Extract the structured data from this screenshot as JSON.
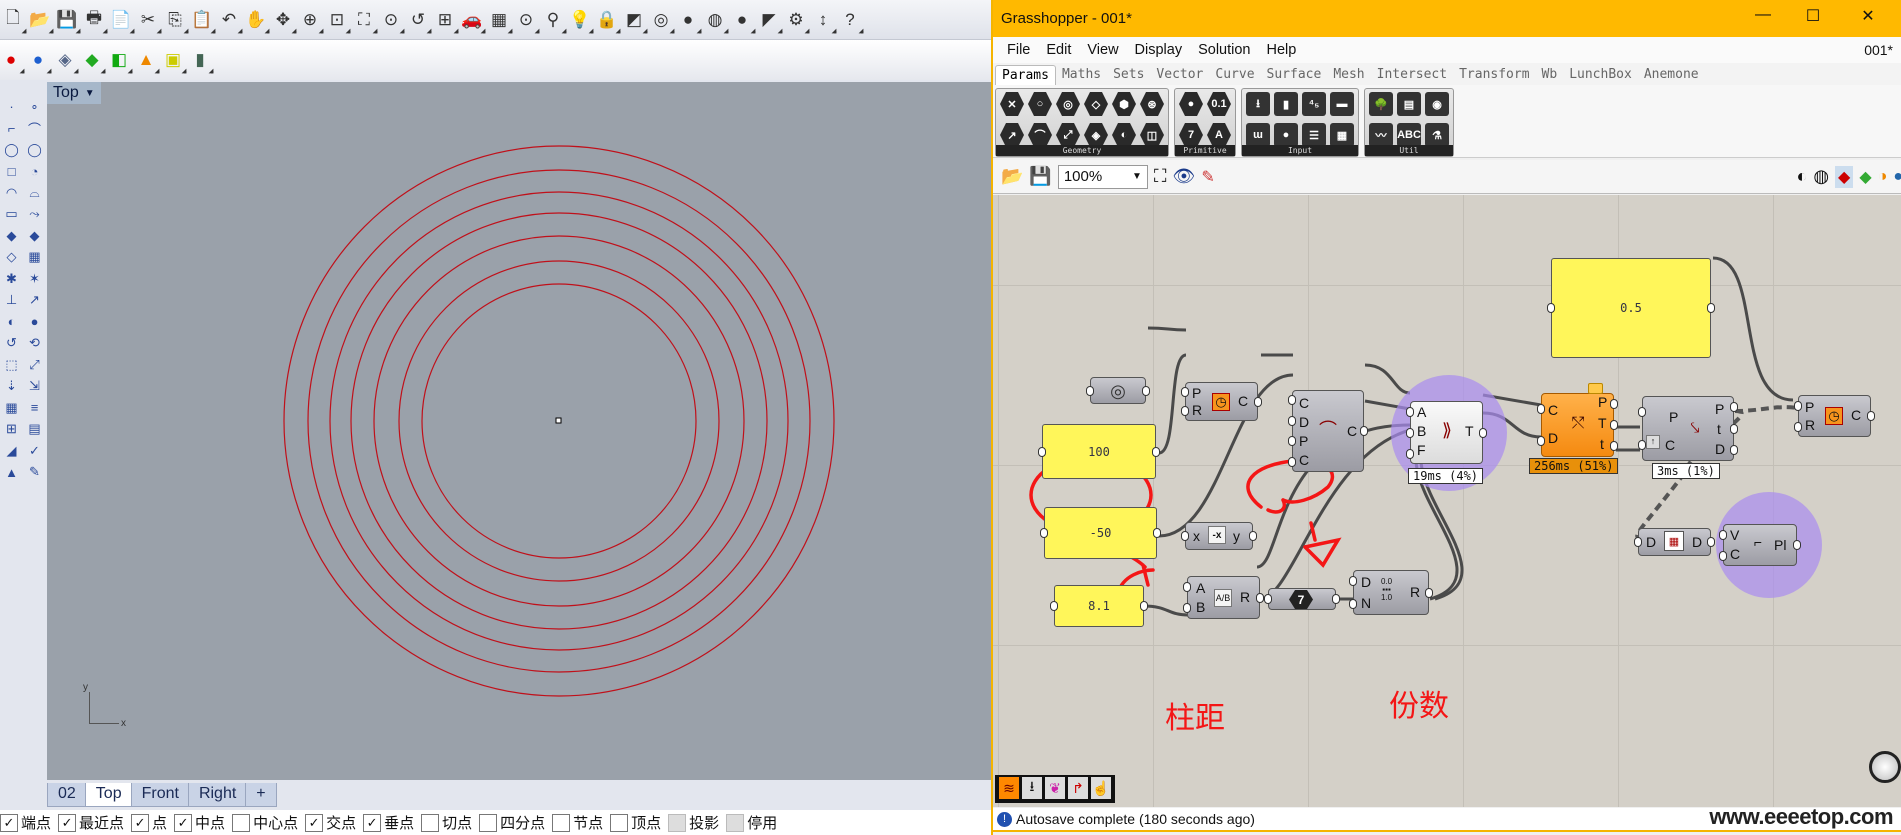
{
  "rhino": {
    "toolbar1_icons": [
      "new-icon",
      "open-icon",
      "save-icon",
      "print-icon",
      "import-icon",
      "cut-icon",
      "copy-icon",
      "paste-icon",
      "undo-icon",
      "pan-icon",
      "rotate-view-icon",
      "zoom-icon",
      "zoom-window-icon",
      "zoom-extents-icon",
      "zoom-selected-icon",
      "undo-view-icon",
      "four-viewports-icon",
      "car-icon",
      "grid-icon",
      "osnap-icon",
      "properties-icon",
      "light-icon",
      "lock-icon",
      "layer-icon",
      "color-wheel-icon",
      "shaded-sphere-icon",
      "rendered-sphere-icon",
      "blue-sphere-icon",
      "flag-icon",
      "settings-icon",
      "dimension-icon",
      "help-icon"
    ],
    "toolbar1_glyphs": [
      "🗋",
      "📂",
      "💾",
      "🖶",
      "📄",
      "✂",
      "⎘",
      "📋",
      "↶",
      "✋",
      "✥",
      "⊕",
      "⊡",
      "⛶",
      "⊙",
      "↺",
      "⊞",
      "🚗",
      "▦",
      "⊙",
      "⚲",
      "💡",
      "🔒",
      "◩",
      "◎",
      "●",
      "◍",
      "●",
      "◤",
      "⚙",
      "↕",
      "?"
    ],
    "toolbar2_icons": [
      "red-sphere-icon",
      "blue-sphere-icon",
      "gem-icon",
      "mesh-icon",
      "box-icon",
      "cone-icon",
      "cage-icon",
      "cylinder-icon"
    ],
    "toolbar2_glyphs": [
      "●",
      "●",
      "◈",
      "◆",
      "◧",
      "▲",
      "▣",
      "▮"
    ],
    "viewport_label": "Top",
    "axis_x": "x",
    "axis_y": "y",
    "circle_color": "#c0101a",
    "viewport_tabs": [
      "02",
      "Top",
      "Front",
      "Right",
      "+"
    ],
    "active_tab": "Top",
    "osnaps": [
      {
        "label": "端点",
        "checked": true
      },
      {
        "label": "最近点",
        "checked": true
      },
      {
        "label": "点",
        "checked": true
      },
      {
        "label": "中点",
        "checked": true
      },
      {
        "label": "中心点",
        "checked": false
      },
      {
        "label": "交点",
        "checked": true
      },
      {
        "label": "垂点",
        "checked": true
      },
      {
        "label": "切点",
        "checked": false
      },
      {
        "label": "四分点",
        "checked": false
      },
      {
        "label": "节点",
        "checked": false
      },
      {
        "label": "顶点",
        "checked": false
      },
      {
        "label": "投影",
        "checked": false,
        "disabled": true
      },
      {
        "label": "停用",
        "checked": false,
        "disabled": true
      }
    ]
  },
  "grasshopper": {
    "title": "Grasshopper - 001*",
    "doc_name": "001*",
    "window_controls": {
      "minimize": "—",
      "maximize": "☐",
      "close": "✕"
    },
    "menu": [
      "File",
      "Edit",
      "View",
      "Display",
      "Solution",
      "Help"
    ],
    "tabs": [
      "Params",
      "Maths",
      "Sets",
      "Vector",
      "Curve",
      "Surface",
      "Mesh",
      "Intersect",
      "Transform",
      "Wb",
      "LunchBox",
      "Anemone"
    ],
    "active_tab": "Params",
    "ribbon_groups": [
      {
        "label": "Geometry",
        "icons": [
          "✕",
          "↗",
          "○",
          "⌒",
          "◎",
          "⤢",
          "◇",
          "◈",
          "⬢",
          "◐",
          "⊛",
          "◫"
        ]
      },
      {
        "label": "Primitive",
        "icons": [
          "●",
          "7",
          "0.1",
          "A"
        ]
      },
      {
        "label": "Input",
        "icons": [
          "⭳",
          "ɯ",
          "▮",
          "●",
          "⁴₅",
          "☰",
          "▬",
          "▦"
        ]
      },
      {
        "label": "Util",
        "icons": [
          "🌳",
          "〰",
          "▤",
          "ABC",
          "◉",
          "⚗"
        ]
      }
    ],
    "zoom_level": "100%",
    "accent": "#ffb900",
    "canvas": {
      "panels": {
        "p05": "0.5",
        "p100": "100",
        "pm50": "-50",
        "p81": "8.1"
      },
      "components": {
        "circle1": {
          "inputs": [
            "P",
            "R"
          ],
          "outputs": [
            "C"
          ]
        },
        "arc": {
          "inputs": [
            "C",
            "D",
            "P",
            "C"
          ],
          "outputs": [
            "C"
          ]
        },
        "tween": {
          "inputs": [
            "A",
            "B",
            "F"
          ],
          "outputs": [
            "T"
          ],
          "timing": "19ms (4%)"
        },
        "divide": {
          "inputs": [
            "C",
            "D"
          ],
          "outputs": [
            "P",
            "T",
            "t"
          ],
          "timing": "256ms (51%)"
        },
        "evaluate": {
          "inputs": [
            "P",
            "C"
          ],
          "outputs": [
            "P",
            "t",
            "D"
          ],
          "timing": "3ms (1%)"
        },
        "circle2": {
          "inputs": [
            "P",
            "R"
          ],
          "outputs": [
            "C"
          ]
        },
        "negative": {
          "inputs": [
            "x"
          ],
          "outputs": [
            "y"
          ],
          "icon": "-x"
        },
        "division": {
          "inputs": [
            "A",
            "B"
          ],
          "outputs": [
            "R"
          ],
          "icon": "A/B"
        },
        "integer": {
          "value": "7"
        },
        "range": {
          "inputs": [
            "D",
            "N"
          ],
          "outputs": [
            "R"
          ],
          "icon_top": "0.0",
          "icon_bottom": "1.0"
        },
        "flatten": {
          "inputs": [
            "D"
          ],
          "outputs": [
            "D"
          ]
        },
        "polyline": {
          "inputs": [
            "V",
            "C"
          ],
          "outputs": [
            "Pl"
          ]
        }
      },
      "annotations": {
        "spacing": "柱距",
        "count": "份数"
      }
    },
    "status": "Autosave complete (180 seconds ago)",
    "watermark": "www.eeeetop.com"
  }
}
